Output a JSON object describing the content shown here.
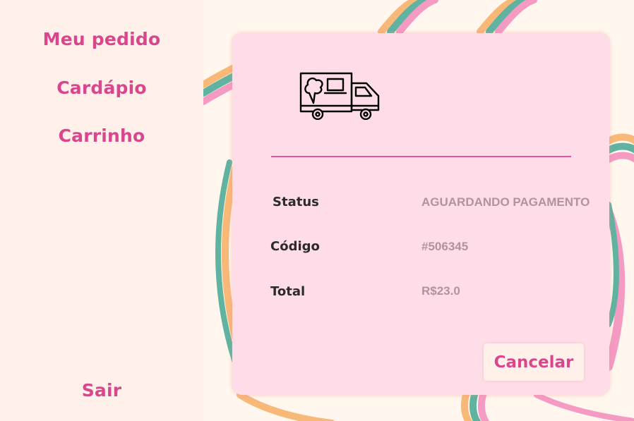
{
  "sidebar": {
    "items": [
      {
        "label": "Meu pedido"
      },
      {
        "label": "Cardápio"
      },
      {
        "label": "Carrinho"
      }
    ],
    "logout_label": "Sair"
  },
  "order": {
    "icon": "ice-cream-truck-icon",
    "status_label": "Status",
    "status_value": "AGUARDANDO PAGAMENTO",
    "code_label": "Código",
    "code_value": "#506345",
    "total_label": "Total",
    "total_value": "R$23.0",
    "cancel_label": "Cancelar"
  },
  "colors": {
    "accent": "#d9468e",
    "card_bg": "#ffdde8",
    "sidebar_bg": "#fff1ea",
    "page_bg": "#fff7ee",
    "wave_orange": "#f8b878",
    "wave_teal": "#5fb3a0",
    "wave_pink": "#f49ac3"
  }
}
